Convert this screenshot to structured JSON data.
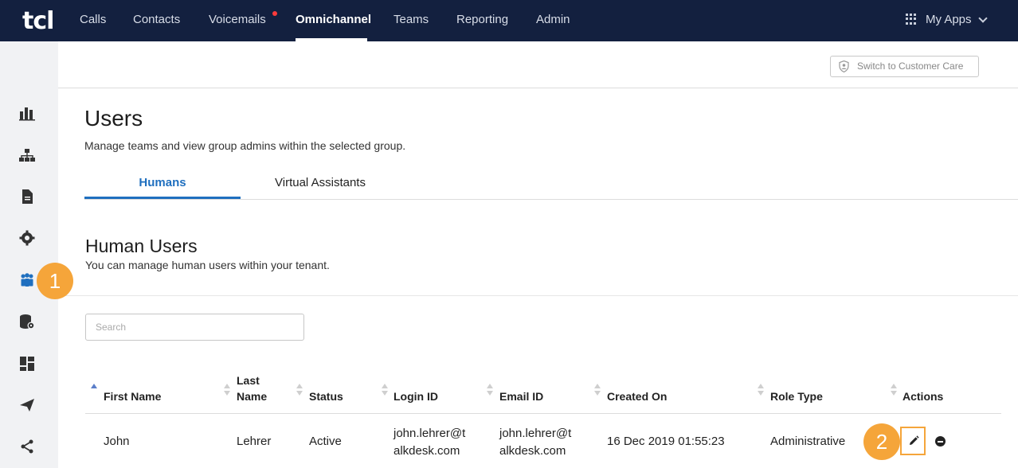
{
  "nav": {
    "logo": "tcl",
    "items": [
      {
        "label": "Calls"
      },
      {
        "label": "Contacts"
      },
      {
        "label": "Voicemails",
        "has_notification": true
      },
      {
        "label": "Omnichannel",
        "active": true
      },
      {
        "label": "Teams"
      },
      {
        "label": "Reporting"
      },
      {
        "label": "Admin"
      }
    ],
    "my_apps": "My Apps"
  },
  "sidebar": {
    "icons": [
      "bar-chart-icon",
      "org-chart-icon",
      "document-icon",
      "gear-icon",
      "users-icon",
      "database-settings-icon",
      "dashboard-icon",
      "send-icon",
      "share-icon"
    ]
  },
  "header": {
    "switch_label": "Switch to Customer Care"
  },
  "page": {
    "title": "Users",
    "subtitle": "Manage teams and view group admins within the selected group."
  },
  "tabs": [
    {
      "label": "Humans",
      "active": true
    },
    {
      "label": "Virtual Assistants"
    }
  ],
  "section": {
    "title": "Human Users",
    "subtitle": "You can manage human users within your tenant."
  },
  "search": {
    "placeholder": "Search",
    "value": ""
  },
  "table": {
    "columns": [
      {
        "label": "First Name",
        "sort": "asc"
      },
      {
        "label": "Last Name"
      },
      {
        "label": "Status"
      },
      {
        "label": "Login ID"
      },
      {
        "label": "Email ID"
      },
      {
        "label": "Created On"
      },
      {
        "label": "Role Type"
      },
      {
        "label": "Actions"
      }
    ],
    "rows": [
      {
        "first_name": "John",
        "last_name": "Lehrer",
        "status": "Active",
        "login_id": "john.lehrer@talkdesk.com",
        "email_id": "john.lehrer@talkdesk.com",
        "created_on": "16 Dec 2019 01:55:23",
        "role_type": "Administrative"
      }
    ]
  },
  "callouts": {
    "step1": "1",
    "step2": "2"
  },
  "colors": {
    "nav_bg": "#13203f",
    "accent_blue": "#1f6fbf",
    "callout_orange": "#f5a53a",
    "notification_red": "#ff3b3b"
  }
}
